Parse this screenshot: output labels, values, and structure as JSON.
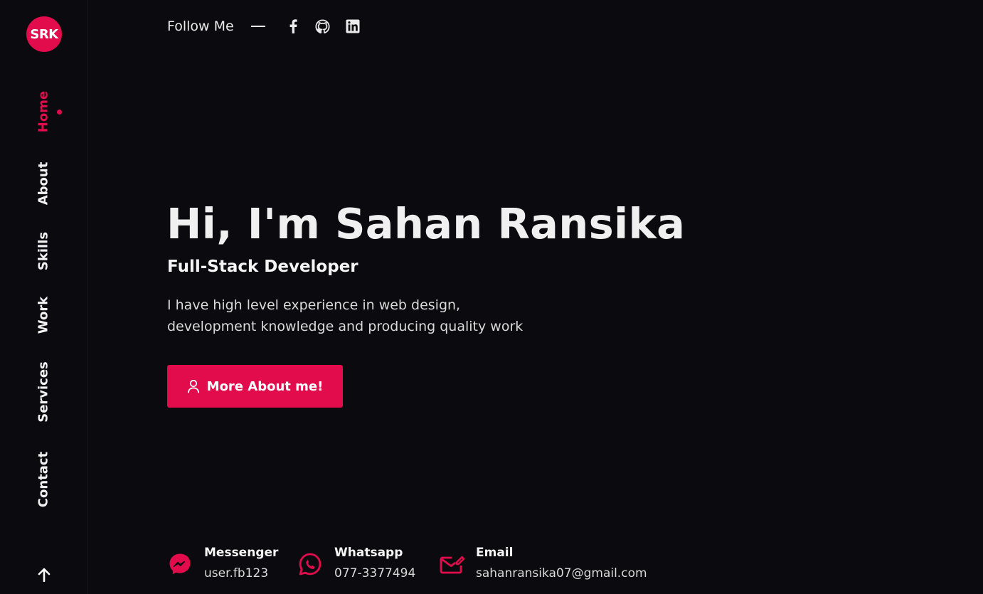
{
  "brand": {
    "logo_text": "SRK",
    "accent": "#e20b4c"
  },
  "nav": {
    "items": [
      {
        "label": "Home",
        "active": true
      },
      {
        "label": "About",
        "active": false
      },
      {
        "label": "Skills",
        "active": false
      },
      {
        "label": "Work",
        "active": false
      },
      {
        "label": "Services",
        "active": false
      },
      {
        "label": "Contact",
        "active": false
      }
    ],
    "scroll_top_icon": "arrow-up-icon"
  },
  "social": {
    "label": "Follow Me",
    "icons": [
      "facebook-icon",
      "github-icon",
      "linkedin-icon"
    ]
  },
  "hero": {
    "title": "Hi, I'm Sahan Ransika",
    "subtitle": "Full-Stack Developer",
    "description_line1": "I have high level experience in web design,",
    "description_line2": "development knowledge and producing quality work",
    "cta_label": "More About me!",
    "cta_icon": "user-icon"
  },
  "contacts": [
    {
      "title": "Messenger",
      "value": "user.fb123",
      "icon": "messenger-icon"
    },
    {
      "title": "Whatsapp",
      "value": "077-3377494",
      "icon": "whatsapp-icon"
    },
    {
      "title": "Email",
      "value": "sahanransika07@gmail.com",
      "icon": "email-icon"
    }
  ]
}
